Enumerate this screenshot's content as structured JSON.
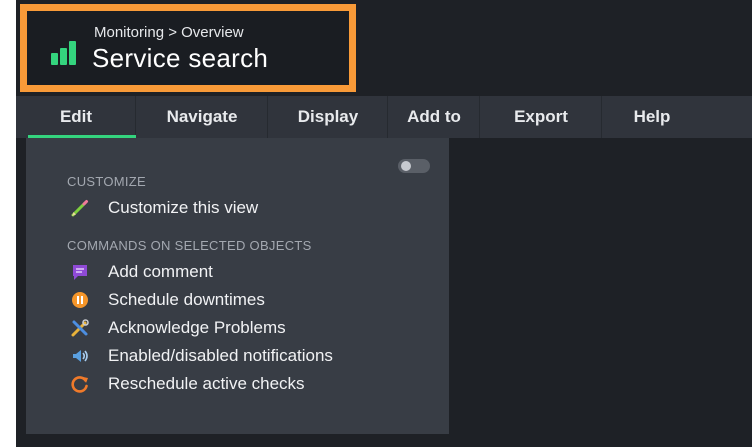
{
  "header": {
    "breadcrumb": "Monitoring > Overview",
    "title": "Service search",
    "logo_icon": "bar-chart-logo-icon",
    "highlight_color": "#f89a38",
    "accent_color": "#34d47e"
  },
  "menubar": {
    "items": [
      {
        "label": "Edit",
        "active": true
      },
      {
        "label": "Navigate"
      },
      {
        "label": "Display"
      },
      {
        "label": "Add to"
      },
      {
        "label": "Export"
      },
      {
        "label": "Help"
      }
    ]
  },
  "panel": {
    "toggle_state": "off",
    "customize": {
      "heading": "CUSTOMIZE",
      "items": [
        {
          "label": "Customize this view",
          "icon": "pencil-icon"
        }
      ]
    },
    "commands": {
      "heading": "COMMANDS ON SELECTED OBJECTS",
      "items": [
        {
          "label": "Add comment",
          "icon": "comment-icon"
        },
        {
          "label": "Schedule downtimes",
          "icon": "pause-icon"
        },
        {
          "label": "Acknowledge Problems",
          "icon": "tools-icon"
        },
        {
          "label": "Enabled/disabled notifications",
          "icon": "speaker-icon"
        },
        {
          "label": "Reschedule active checks",
          "icon": "refresh-icon"
        }
      ]
    }
  }
}
